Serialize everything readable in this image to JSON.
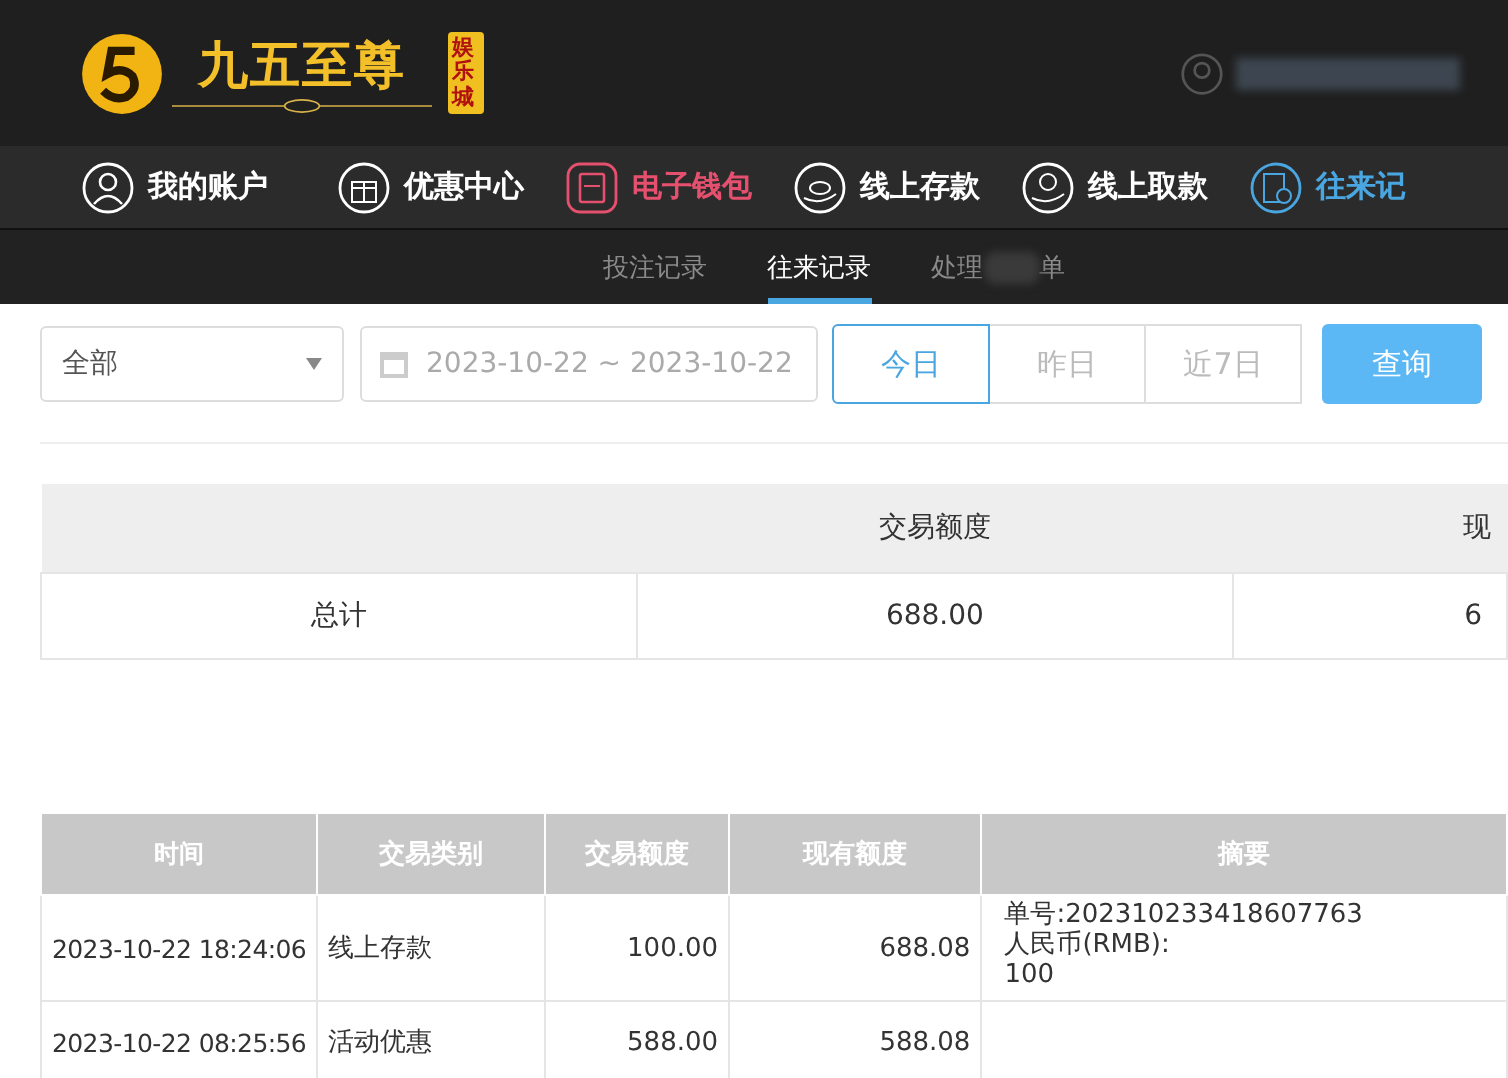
{
  "logo": {
    "title": "九五至尊",
    "badge": "娱乐城"
  },
  "nav": [
    {
      "label": "我的账户",
      "kind": "user",
      "color": "#ffffff"
    },
    {
      "label": "优惠中心",
      "kind": "gift",
      "color": "#ffffff"
    },
    {
      "label": "电子钱包",
      "kind": "wallet",
      "color": "#e5506e"
    },
    {
      "label": "线上存款",
      "kind": "deposit",
      "color": "#ffffff"
    },
    {
      "label": "线上取款",
      "kind": "withdraw",
      "color": "#ffffff"
    },
    {
      "label": "往来记",
      "kind": "record",
      "color": "#4aa6e0"
    }
  ],
  "subtabs": [
    {
      "label": "投注记录",
      "selected": false
    },
    {
      "label": "往来记录",
      "selected": true
    },
    {
      "label": "处理",
      "suffix": "单",
      "selected": false
    }
  ],
  "filter": {
    "type": "全部",
    "date_range": "2023-10-22 ~ 2023-10-22",
    "ranges": [
      {
        "label": "今日",
        "selected": true
      },
      {
        "label": "昨日",
        "selected": false
      },
      {
        "label": "近7日",
        "selected": false
      }
    ],
    "search": "查询"
  },
  "summary": {
    "columns": [
      "交易额度",
      "现"
    ],
    "row": [
      "总计",
      "688.00",
      "6"
    ]
  },
  "table": {
    "columns": [
      "时间",
      "交易类别",
      "交易额度",
      "现有额度",
      "摘要"
    ],
    "rows": [
      [
        "2023-10-22 18:24:06",
        "线上存款",
        "100.00",
        "688.08",
        [
          "单号:202310233418607763",
          "人民币(RMB):",
          "100"
        ]
      ],
      [
        "2023-10-22 08:25:56",
        "活动优惠",
        "588.00",
        "588.08",
        []
      ]
    ]
  }
}
